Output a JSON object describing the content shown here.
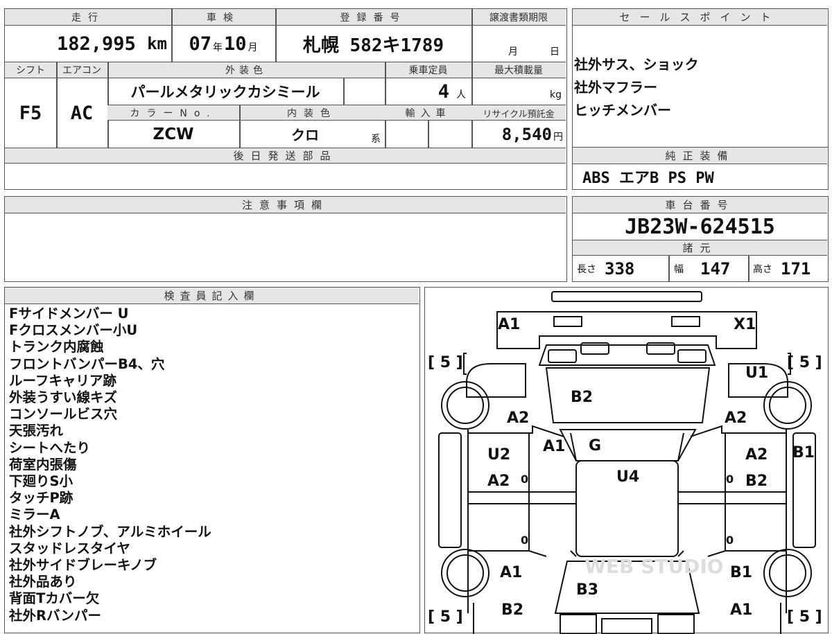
{
  "main_table": {
    "headers": {
      "mileage": "走行",
      "inspection": "車検",
      "registration": "登録番号",
      "transfer_deadline": "譲渡書類期限",
      "shift": "シフト",
      "aircon": "エアコン",
      "exterior_color": "外装色",
      "capacity": "乗車定員",
      "max_load": "最大積載量",
      "color_no": "カラーNo.",
      "interior_color": "内装色",
      "import": "輸入車",
      "recycle_fee": "リサイクル預託金",
      "later_parts": "後日発送部品"
    },
    "values": {
      "mileage": "182,995",
      "mileage_unit": "km",
      "inspection_year": "07",
      "year_unit": "年",
      "inspection_month": "10",
      "month_unit": "月",
      "registration": "札幌 582キ1789",
      "deadline_month": "月",
      "deadline_day": "日",
      "shift": "F5",
      "aircon": "AC",
      "exterior_color": "パールメタリックカシミール",
      "capacity": "4",
      "capacity_unit": "人",
      "max_load_unit": "kg",
      "color_no": "ZCW",
      "interior_color": "クロ",
      "interior_suffix": "系",
      "recycle_fee": "8,540",
      "recycle_unit": "円"
    }
  },
  "sales_points": {
    "header": "セールスポイント",
    "lines": [
      "社外サス、ショック",
      "社外マフラー",
      "ヒッチメンバー"
    ]
  },
  "genuine_equipment": {
    "header": "純正装備",
    "value": "ABS エアB PS PW"
  },
  "notes": {
    "header": "注意事項欄"
  },
  "chassis": {
    "header": "車台番号",
    "value": "JB23W-624515"
  },
  "specs": {
    "header": "諸元",
    "length_label": "長さ",
    "length": "338",
    "width_label": "幅",
    "width": "147",
    "height_label": "高さ",
    "height": "171"
  },
  "inspector": {
    "header": "検査員記入欄",
    "lines": [
      "Fサイドメンバー U",
      "Fクロスメンバー小U",
      "トランク内腐蝕",
      "フロントバンパーB4、穴",
      "ルーフキャリア跡",
      "外装うすい線キズ",
      "コンソールビス穴",
      "天張汚れ",
      "シートへたり",
      "荷室内張傷",
      "下廻りS小",
      "タッチP跡",
      "ミラーA",
      "社外シフトノブ、アルミホイール",
      "スタッドレスタイヤ",
      "社外サイドブレーキノブ",
      "社外品あり",
      "背面Tカバー欠",
      "社外Rバンパー"
    ]
  },
  "diagram": {
    "tire_labels": [
      "[ 5 ]",
      "[ 5 ]",
      "[ 5 ]",
      "[ 5 ]"
    ],
    "marks": {
      "front_left": "A1",
      "front_right": "X1",
      "hood": "B2",
      "left_front_fender": "A2",
      "right_front_fender": "A2",
      "right_fender_top": "U1",
      "windshield_left": "A1",
      "windshield": "G",
      "roof": "U4",
      "left_door_upper": "U2",
      "left_door_lower": "A2",
      "right_door_upper": "A2",
      "right_door_lower": "B2",
      "right_mirror": "B1",
      "left_rear_wheel": "A1",
      "right_rear_wheel": "B1",
      "rear_glass": "B3",
      "left_rear_corner": "B2",
      "right_rear_corner": "A1",
      "zero_mark": "0"
    },
    "watermark": "WEB STUDIO"
  }
}
